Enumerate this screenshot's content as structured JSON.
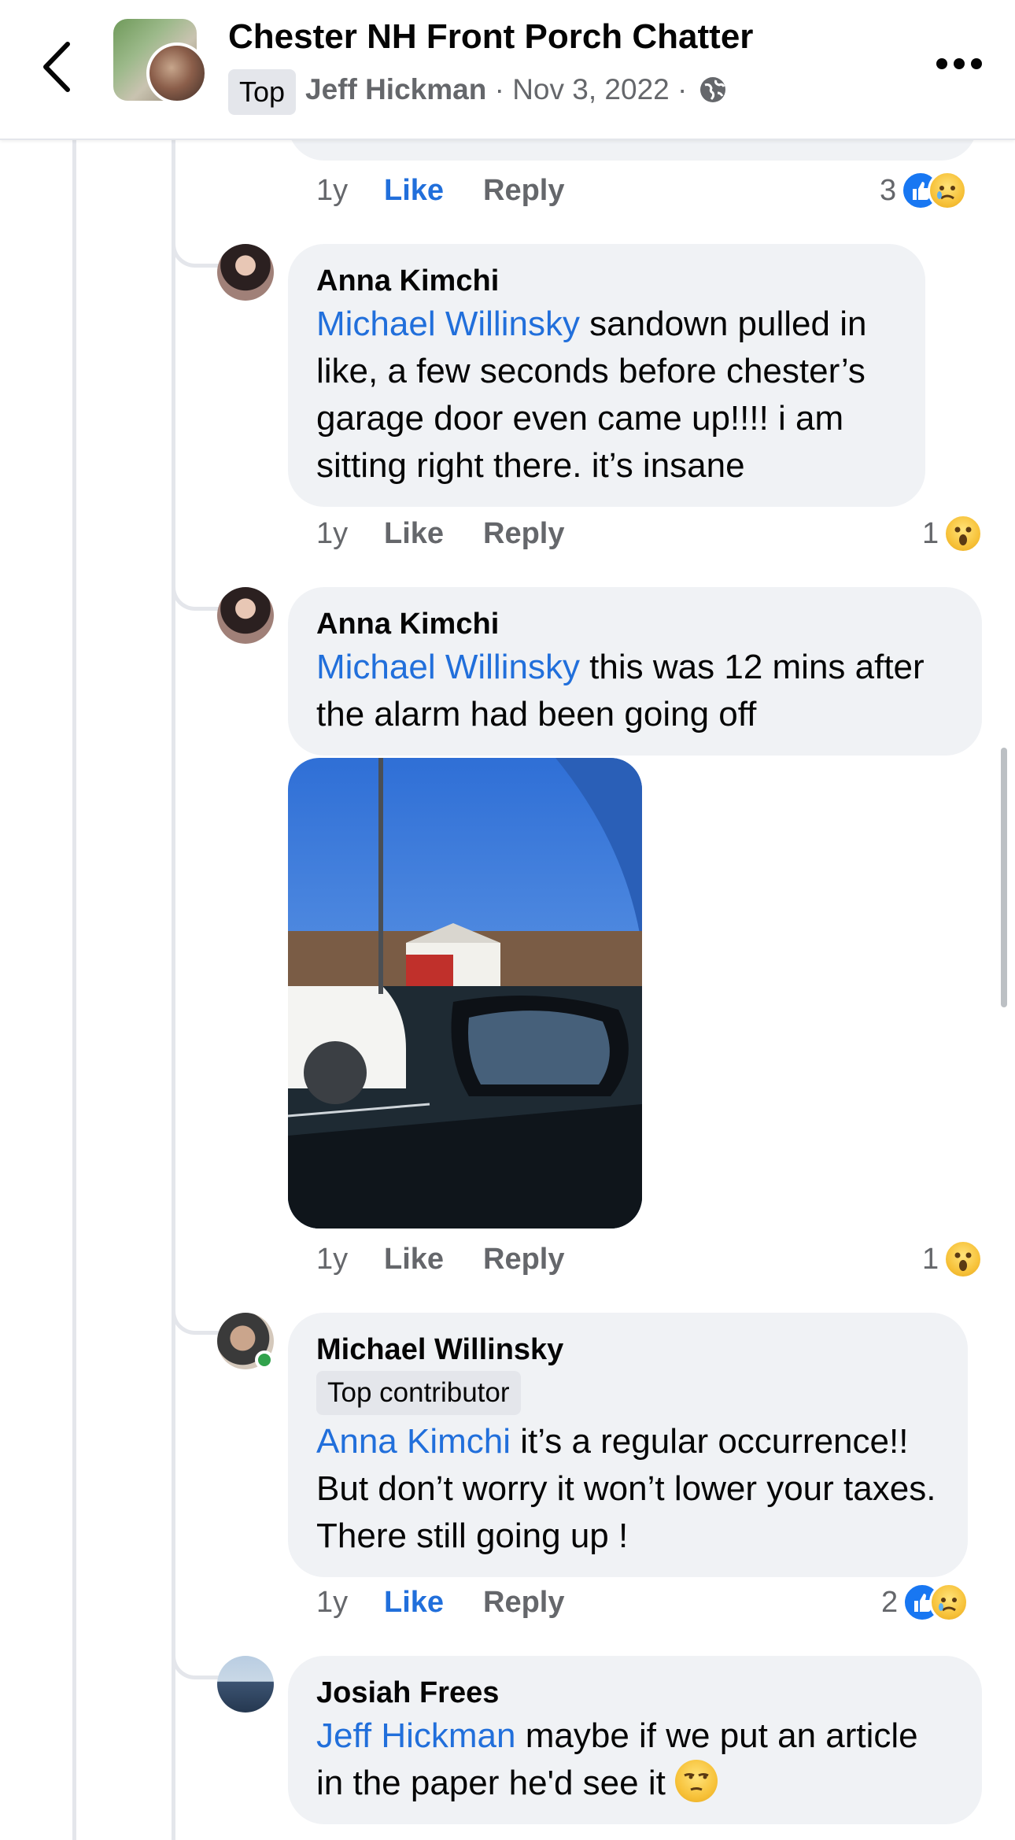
{
  "header": {
    "group_title": "Chester NH Front Porch Chatter",
    "badge": "Top",
    "author": "Jeff Hickman",
    "separator1": " · ",
    "date": "Nov 3, 2022",
    "separator2": " · ",
    "privacy_icon": "globe-icon",
    "back_icon": "chevron-left-icon",
    "more_icon": "more-dots-icon"
  },
  "top_actions": {
    "age": "1y",
    "like": "Like",
    "reply": "Reply",
    "react_count": "3",
    "reactions": [
      "like",
      "sad"
    ]
  },
  "comments": [
    {
      "author": "Anna Kimchi",
      "mention": "Michael Willinsky",
      "text": " sandown pulled in like, a few seconds before chester’s garage door even came up!!!! i am sitting right there. it’s insane",
      "age": "1y",
      "like": "Like",
      "reply": "Reply",
      "react_count": "1",
      "reactions": [
        "wow"
      ]
    },
    {
      "author": "Anna Kimchi",
      "mention": "Michael Willinsky",
      "text": " this was 12 mins after the alarm had been going off",
      "has_photo": true,
      "photo_alt": "photo through car window of fire station",
      "age": "1y",
      "like": "Like",
      "reply": "Reply",
      "react_count": "1",
      "reactions": [
        "wow"
      ]
    },
    {
      "author": "Michael Willinsky",
      "badge": "Top contributor",
      "mention": "Anna Kimchi",
      "text": " it’s a regular occurrence!! But don’t worry it won’t lower your taxes. There still going up !",
      "age": "1y",
      "like": "Like",
      "reply": "Reply",
      "react_count": "2",
      "reactions": [
        "like",
        "sad"
      ]
    },
    {
      "author": "Josiah Frees",
      "mention": "Jeff Hickman",
      "text": " maybe if we put an article in the paper he'd see it",
      "trailing_emoji": "unamused-face"
    }
  ],
  "colors": {
    "link": "#216fdb",
    "bubble": "#f0f2f5",
    "secondary_text": "#65676b",
    "like_blue": "#1877f2"
  }
}
